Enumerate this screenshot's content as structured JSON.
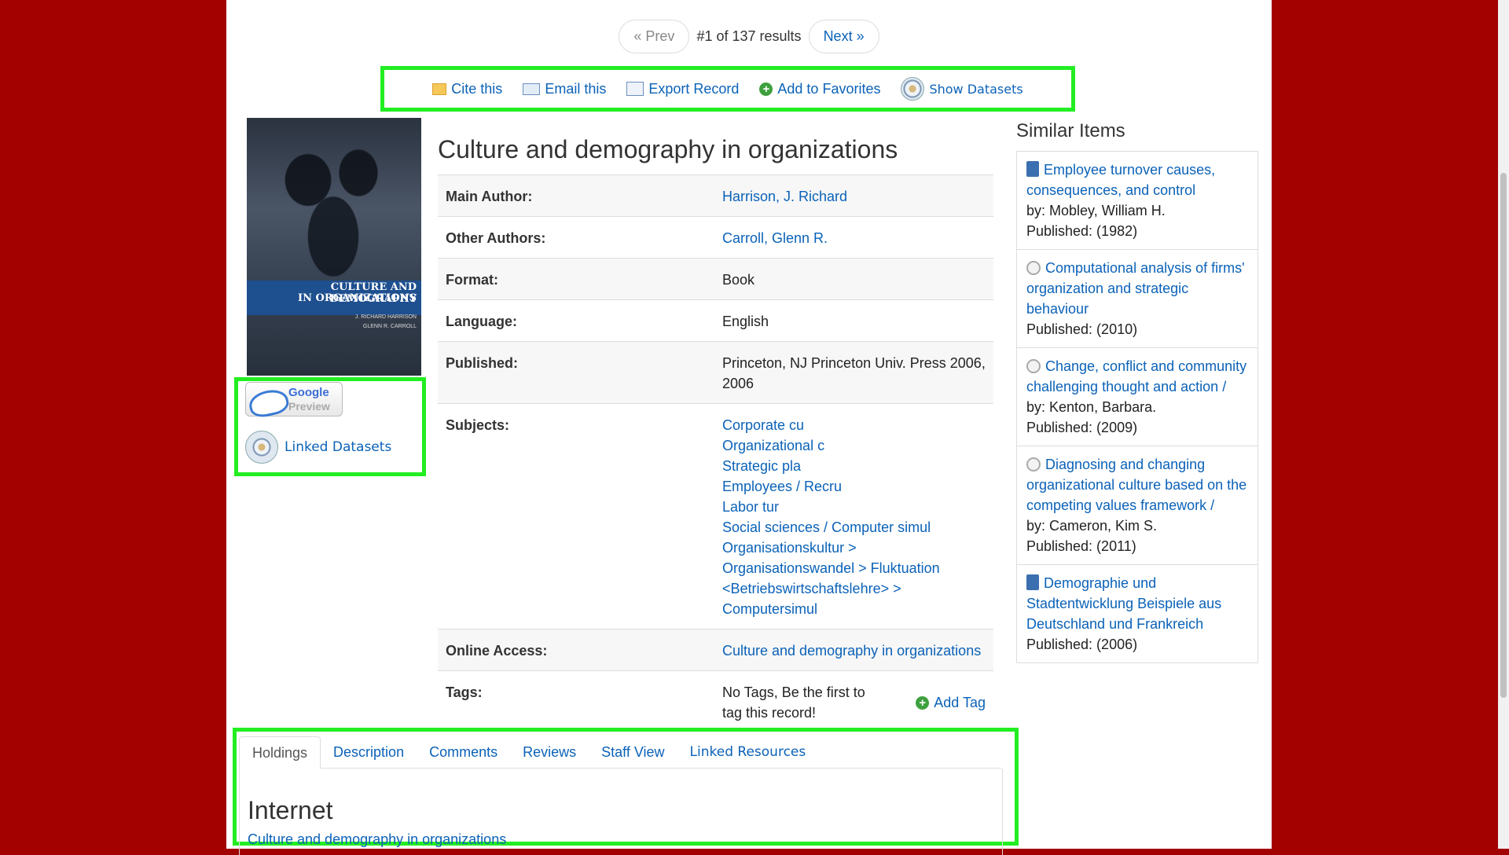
{
  "pager": {
    "prev": "« Prev",
    "count": "#1 of 137 results",
    "next": "Next »"
  },
  "toolbar": {
    "cite": "Cite this",
    "email": "Email this",
    "export": "Export Record",
    "favorites": "Add to Favorites",
    "datasets": "Show Datasets"
  },
  "cover": {
    "title_line1": "CULTURE AND DEMOGRAPHY",
    "title_line2": "IN ORGANIZATIONS",
    "author1": "J. RICHARD HARRISON",
    "author2": "GLENN R. CARROLL"
  },
  "google_preview": {
    "line1": "Google",
    "line2": "Preview"
  },
  "linked_datasets": "Linked Datasets",
  "record": {
    "title": "Culture and demography in organizations",
    "fields": {
      "main_author": {
        "label": "Main Author:",
        "value": "Harrison, J. Richard"
      },
      "other_authors": {
        "label": "Other Authors:",
        "value": "Carroll, Glenn R."
      },
      "format": {
        "label": "Format:",
        "value": "Book"
      },
      "language": {
        "label": "Language:",
        "value": "English"
      },
      "published": {
        "label": "Published:",
        "value": "Princeton, NJ Princeton Univ. Press 2006, 2006"
      },
      "subjects": {
        "label": "Subjects:",
        "values": [
          "Corporate cu",
          "Organizational c",
          "Strategic pla",
          "Employees / Recru",
          "Labor tur",
          "Social sciences / Computer simul",
          "Organisationskultur >",
          "Organisationswandel > Fluktuation",
          "<Betriebswirtschaftslehre> >",
          "Computersimul"
        ]
      },
      "online_access": {
        "label": "Online Access:",
        "value": "Culture and demography in organizations"
      },
      "tags": {
        "label": "Tags:",
        "value": "No Tags, Be the first to tag this record!",
        "add": "Add Tag"
      }
    }
  },
  "similar": {
    "heading": "Similar Items",
    "items": [
      {
        "icon": "book-icon",
        "title": "Employee turnover causes, consequences, and control",
        "by": "by: Mobley, William H.",
        "published": "Published: (1982)"
      },
      {
        "icon": "disk-icon",
        "title": "Computational analysis of firms' organization and strategic behaviour",
        "by": "",
        "published": "Published: (2010)"
      },
      {
        "icon": "disk-icon",
        "title": "Change, conflict and community challenging thought and action /",
        "by": "by: Kenton, Barbara.",
        "published": "Published: (2009)"
      },
      {
        "icon": "disk-icon",
        "title": "Diagnosing and changing organizational culture based on the competing values framework /",
        "by": "by: Cameron, Kim S.",
        "published": "Published: (2011)"
      },
      {
        "icon": "book-icon",
        "title": "Demographie und Stadtentwicklung Beispiele aus Deutschland und Frankreich",
        "by": "",
        "published": "Published: (2006)"
      }
    ]
  },
  "tabs": [
    "Holdings",
    "Description",
    "Comments",
    "Reviews",
    "Staff View",
    "Linked Resources"
  ],
  "holdings": {
    "heading": "Internet",
    "link": "Culture and demography in organizations"
  },
  "colors": {
    "highlight": "#22ee22",
    "link": "#0b62b8",
    "background": "#a30000"
  }
}
